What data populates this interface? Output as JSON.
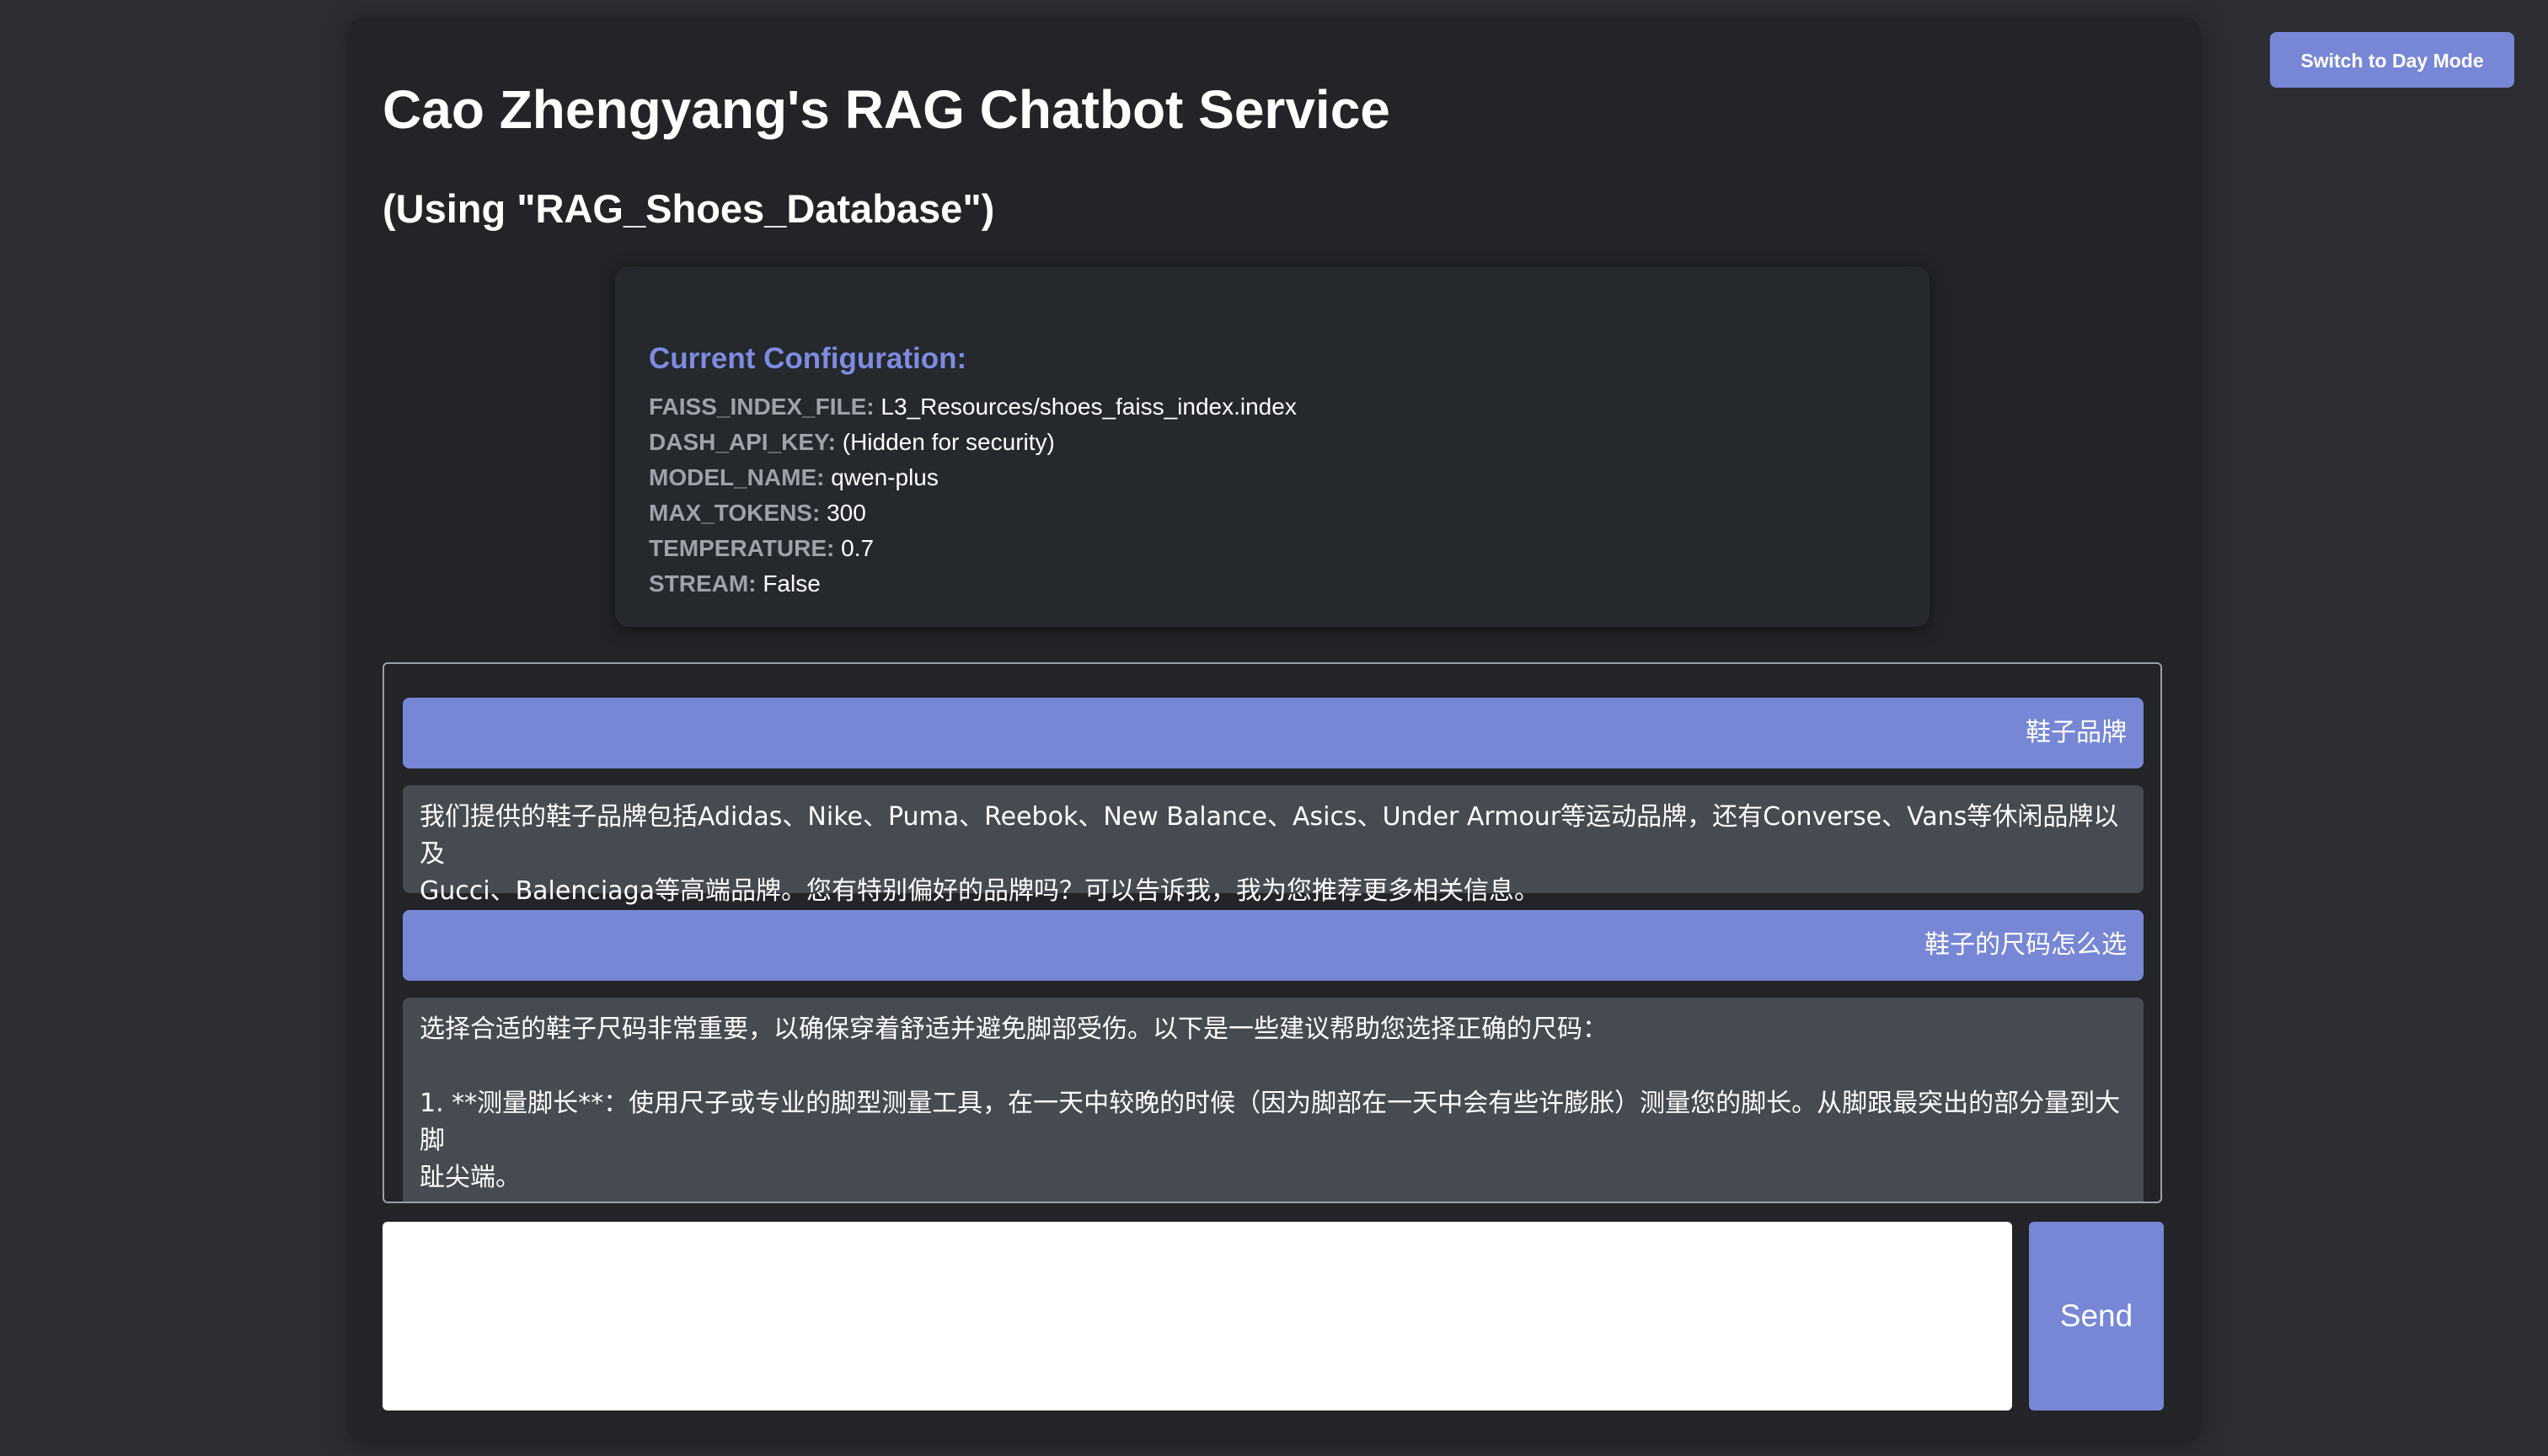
{
  "header": {
    "mode_toggle_label": "Switch to Day Mode"
  },
  "main": {
    "title": "Cao Zhengyang's RAG Chatbot Service",
    "subtitle": "(Using \"RAG_Shoes_Database\")"
  },
  "config": {
    "heading": "Current Configuration:",
    "items": [
      {
        "key": "FAISS_INDEX_FILE:",
        "value": "L3_Resources/shoes_faiss_index.index"
      },
      {
        "key": "DASH_API_KEY:",
        "value": "(Hidden for security)"
      },
      {
        "key": "MODEL_NAME:",
        "value": "qwen-plus"
      },
      {
        "key": "MAX_TOKENS:",
        "value": "300"
      },
      {
        "key": "TEMPERATURE:",
        "value": "0.7"
      },
      {
        "key": "STREAM:",
        "value": "False"
      }
    ]
  },
  "chat": {
    "messages": [
      {
        "role": "user",
        "text": "鞋子品牌"
      },
      {
        "role": "bot",
        "text": "我们提供的鞋子品牌包括Adidas、Nike、Puma、Reebok、New Balance、Asics、Under Armour等运动品牌，还有Converse、Vans等休闲品牌以及\nGucci、Balenciaga等高端品牌。您有特别偏好的品牌吗？可以告诉我，我为您推荐更多相关信息。"
      },
      {
        "role": "user",
        "text": "鞋子的尺码怎么选"
      },
      {
        "role": "bot",
        "text": "选择合适的鞋子尺码非常重要，以确保穿着舒适并避免脚部受伤。以下是一些建议帮助您选择正确的尺码：\n\n1. **测量脚长**：使用尺子或专业的脚型测量工具，在一天中较晚的时候（因为脚部在一天中会有些许膨胀）测量您的脚长。从脚跟最突出的部分量到大脚\n趾尖端。"
      }
    ],
    "input_value": "",
    "input_placeholder": "",
    "send_label": "Send"
  },
  "colors": {
    "page_background": "#2c2e32",
    "card_background": "#222427",
    "accent": "#7787d6",
    "bot_bubble": "#464a51",
    "config_key": "#9ea3ab"
  }
}
